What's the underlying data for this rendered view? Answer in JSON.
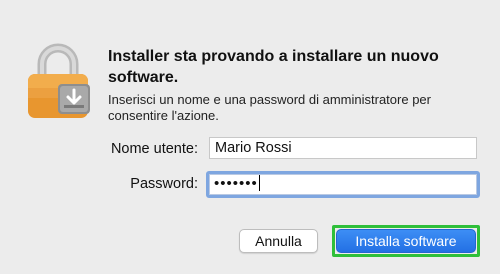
{
  "dialog": {
    "title": "Installer sta provando a installare un nuovo software.",
    "message": "Inserisci un nome e una password di amministratore per consentire l'azione.",
    "icon": "lock-icon"
  },
  "form": {
    "username_label": "Nome utente:",
    "username_value": "Mario Rossi",
    "password_label": "Password:",
    "password_value": "•••••••"
  },
  "buttons": {
    "cancel_label": "Annulla",
    "install_label": "Installa software"
  },
  "colors": {
    "background": "#ececec",
    "accent": "#2370e4",
    "focus_ring": "#7ea6e0",
    "highlight": "#2fbf3a",
    "lock_body": "#f0a23c"
  }
}
